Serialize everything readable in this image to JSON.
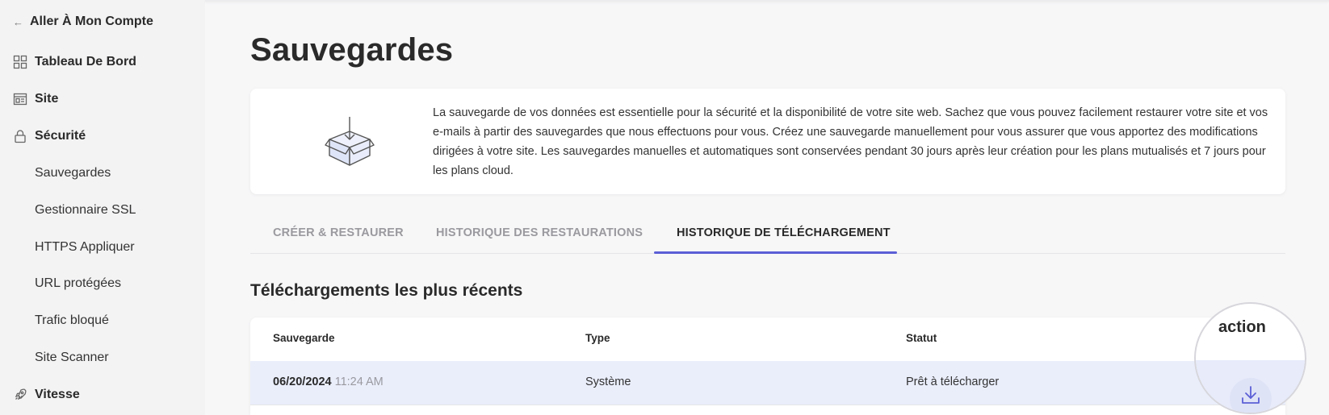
{
  "sidebar": {
    "back_label": "Aller À Mon Compte",
    "items": [
      {
        "label": "Tableau De Bord",
        "icon": "grid-icon"
      },
      {
        "label": "Site",
        "icon": "site-icon"
      },
      {
        "label": "Sécurité",
        "icon": "lock-icon"
      }
    ],
    "sub_items": [
      {
        "label": "Sauvegardes"
      },
      {
        "label": "Gestionnaire SSL"
      },
      {
        "label": "HTTPS Appliquer"
      },
      {
        "label": "URL protégées"
      },
      {
        "label": "Trafic bloqué"
      },
      {
        "label": "Site Scanner"
      }
    ],
    "speed": {
      "label": "Vitesse",
      "icon": "rocket-icon"
    }
  },
  "page": {
    "title": "Sauvegardes"
  },
  "info": {
    "description": "La sauvegarde de vos données est essentielle pour la sécurité et la disponibilité de votre site web. Sachez que vous pouvez facilement restaurer votre site et vos e-mails à partir des sauvegardes que nous effectuons pour vous. Créez une sauvegarde manuellement pour vous assurer que vous apportez des modifications dirigées à votre site. Les sauvegardes manuelles et automatiques sont conservées pendant 30 jours après leur création pour les plans mutualisés et 7 jours pour les plans cloud.",
    "icon": "backup-box-icon"
  },
  "tabs": [
    {
      "label": "CRÉER & RESTAURER",
      "active": false
    },
    {
      "label": "HISTORIQUE DES RESTAURATIONS",
      "active": false
    },
    {
      "label": "HISTORIQUE DE TÉLÉCHARGEMENT",
      "active": true
    }
  ],
  "downloads": {
    "section_title": "Téléchargements les plus récents",
    "columns": [
      "Sauvegarde",
      "Type",
      "Statut",
      "action"
    ],
    "rows": [
      {
        "date": "06/20/2024",
        "time": "11:24 AM",
        "type": "Système",
        "status": "Prêt à télécharger",
        "action_icon": "download-icon"
      }
    ]
  },
  "colors": {
    "accent": "#5b5fd6",
    "row_highlight": "#eaeefb",
    "background": "#f7f7f8"
  }
}
